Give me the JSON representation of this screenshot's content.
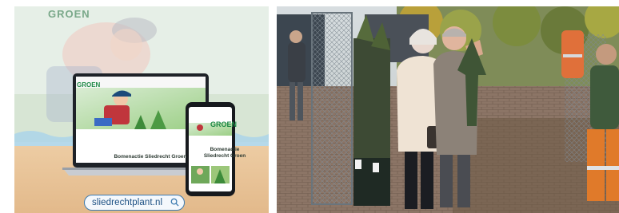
{
  "left_photo": {
    "background_logo": "GROEN",
    "laptop_site_logo": "GROEN",
    "phone_site_logo": "GROEN",
    "laptop_site_headline": "Bomenactie Sliedrecht Groen",
    "phone_site_headline": "Bomenactie Sliedrecht Groen",
    "url": "sliedrechtplant.nl",
    "search_icon": "search-icon",
    "colors": {
      "brand_green": "#1f8a47",
      "url_blue": "#1b4f82"
    }
  },
  "right_photo": {
    "scene": "people holding saplings outdoors"
  }
}
